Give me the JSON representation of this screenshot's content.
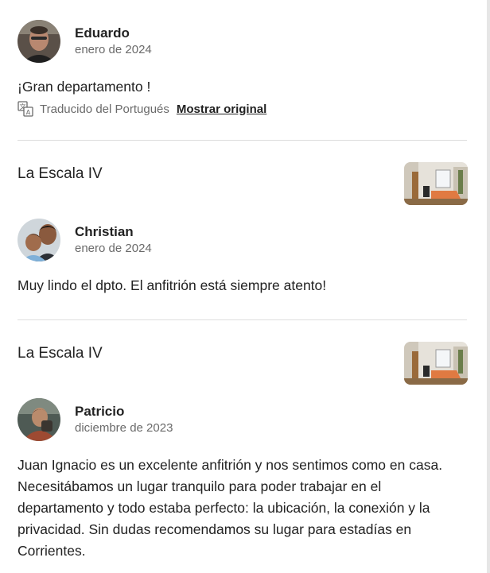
{
  "reviews": [
    {
      "name": "Eduardo",
      "date": "enero de 2024",
      "text": "¡Gran departamento !",
      "translated_label": "Traducido del Portugués",
      "show_original_label": "Mostrar original"
    },
    {
      "listing_title": "La Escala IV",
      "name": "Christian",
      "date": "enero de 2024",
      "text": "Muy lindo el dpto. El anfitrión está siempre atento!"
    },
    {
      "listing_title": "La Escala IV",
      "name": "Patricio",
      "date": "diciembre de 2023",
      "text": "Juan Ignacio es un excelente anfitrión y nos sentimos como en casa. Necesitábamos un lugar tranquilo para poder trabajar en el departamento y todo estaba perfecto: la ubicación, la conexión y la privacidad. Sin dudas recomendamos su lugar para estadías en Corrientes."
    }
  ]
}
